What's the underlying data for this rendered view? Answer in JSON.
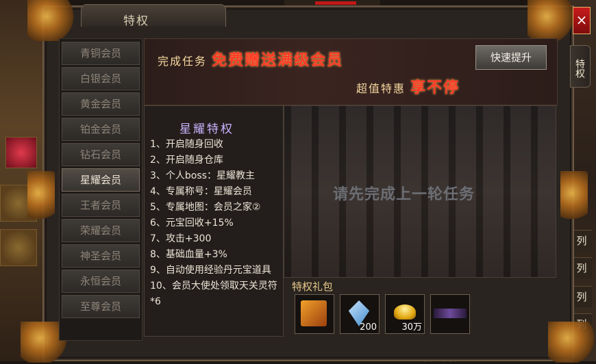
{
  "window": {
    "title": "特权",
    "close_icon": "×",
    "side_tab": "特权"
  },
  "menu": {
    "items": [
      {
        "label": "青铜会员"
      },
      {
        "label": "白银会员"
      },
      {
        "label": "黄金会员"
      },
      {
        "label": "铂金会员"
      },
      {
        "label": "钻石会员"
      },
      {
        "label": "星耀会员"
      },
      {
        "label": "王者会员"
      },
      {
        "label": "荣耀会员"
      },
      {
        "label": "神圣会员"
      },
      {
        "label": "永恒会员"
      },
      {
        "label": "至尊会员"
      }
    ],
    "active": "星耀会员"
  },
  "banner": {
    "line1_small": "完成任务",
    "line1_big": "免费赠送满级会员",
    "line2_small": "超值特惠",
    "line2_big": "享不停",
    "upgrade_button": "快速提升"
  },
  "privileges": {
    "title": "星耀特权",
    "items": [
      "1、开启随身回收",
      "2、开启随身仓库",
      "3、个人boss：星耀教主",
      "4、专属称号：星耀会员",
      "5、专属地图：会员之家②",
      "6、元宝回收+15%",
      "7、攻击+300",
      "8、基础血量+3%",
      "9、自动使用经验丹元宝道具",
      "10、会员大使处领取天关灵符*6"
    ]
  },
  "preview": {
    "message": "请先完成上一轮任务"
  },
  "gift": {
    "label": "特权礼包",
    "items": [
      {
        "icon": "skill-book-icon",
        "count": ""
      },
      {
        "icon": "crystal-icon",
        "count": "200"
      },
      {
        "icon": "gold-ingot-icon",
        "count": "30万"
      },
      {
        "icon": "title-badge-icon",
        "count": ""
      }
    ]
  },
  "background": {
    "right_labels": [
      "列",
      "列",
      "列",
      "列"
    ],
    "bottom_text": "自动回收"
  },
  "colors": {
    "accent_red": "#ff3a28",
    "gold_text": "#f5d9a0",
    "privilege_title": "#c9b2ff"
  }
}
